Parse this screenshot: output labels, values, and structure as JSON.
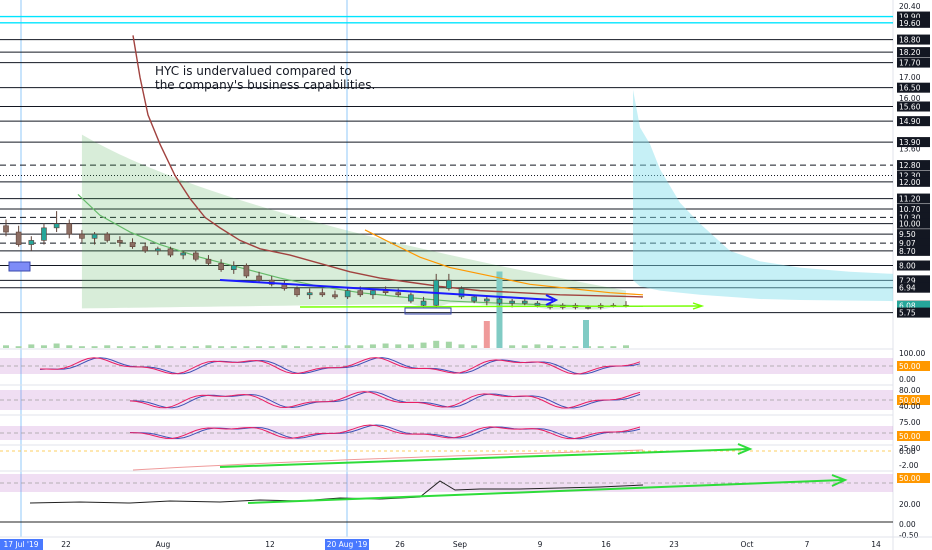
{
  "chart_data": {
    "type": "candlestick",
    "annotation": "HYC is undervalued compared to\nthe company's business capabilities.",
    "price_axis": {
      "labels": [
        "20.40",
        "19.90",
        "19.60",
        "18.80",
        "18.20",
        "17.70",
        "17.00",
        "16.50",
        "16.00",
        "15.60",
        "14.90",
        "13.90",
        "13.60",
        "12.80",
        "12.30",
        "12.00",
        "11.20",
        "10.70",
        "10.30",
        "10.00",
        "9.50",
        "9.07",
        "8.70",
        "8.00",
        "7.29",
        "6.94",
        "6.09",
        "6.08",
        "5.75"
      ],
      "badges": [
        {
          "value": "6.09",
          "color": "#ef5350"
        },
        {
          "value": "6.08",
          "color": "#26a69a"
        },
        {
          "value": "5.75",
          "color": "#131722"
        }
      ],
      "horizontal_levels": [
        {
          "value": "19.90",
          "color": "#00e5ff",
          "style": "solid"
        },
        {
          "value": "19.60",
          "color": "#00e5ff",
          "style": "solid"
        },
        {
          "value": "18.80",
          "color": "#131722",
          "style": "solid"
        },
        {
          "value": "18.20",
          "color": "#131722",
          "style": "solid"
        },
        {
          "value": "17.70",
          "color": "#131722",
          "style": "solid"
        },
        {
          "value": "16.50",
          "color": "#131722",
          "style": "solid"
        },
        {
          "value": "15.60",
          "color": "#131722",
          "style": "solid"
        },
        {
          "value": "14.90",
          "color": "#131722",
          "style": "solid"
        },
        {
          "value": "13.90",
          "color": "#131722",
          "style": "solid"
        },
        {
          "value": "12.80",
          "color": "#131722",
          "style": "dashed"
        },
        {
          "value": "12.30",
          "color": "#131722",
          "style": "dotted"
        },
        {
          "value": "12.00",
          "color": "#131722",
          "style": "solid"
        },
        {
          "value": "11.20",
          "color": "#131722",
          "style": "solid"
        },
        {
          "value": "10.70",
          "color": "#131722",
          "style": "solid"
        },
        {
          "value": "10.30",
          "color": "#131722",
          "style": "dashed"
        },
        {
          "value": "10.00",
          "color": "#131722",
          "style": "solid"
        },
        {
          "value": "9.50",
          "color": "#131722",
          "style": "solid"
        },
        {
          "value": "9.07",
          "color": "#131722",
          "style": "dashed"
        },
        {
          "value": "8.70",
          "color": "#131722",
          "style": "solid"
        },
        {
          "value": "8.00",
          "color": "#131722",
          "style": "solid"
        },
        {
          "value": "7.29",
          "color": "#131722",
          "style": "solid"
        },
        {
          "value": "6.94",
          "color": "#131722",
          "style": "solid"
        },
        {
          "value": "5.75",
          "color": "#131722",
          "style": "solid"
        }
      ]
    },
    "time_axis": {
      "labels": [
        "17 Jul '19",
        "22",
        "Aug",
        "12",
        "20 Aug '19",
        "26",
        "Sep",
        "9",
        "16",
        "23",
        "Oct",
        "7",
        "14"
      ],
      "highlighted": [
        "17 Jul '19",
        "20 Aug '19"
      ]
    },
    "candles": [
      {
        "o": 9.9,
        "h": 10.2,
        "l": 9.4,
        "c": 9.6
      },
      {
        "o": 9.6,
        "h": 9.9,
        "l": 8.9,
        "c": 9.0
      },
      {
        "o": 9.0,
        "h": 9.4,
        "l": 8.7,
        "c": 9.2
      },
      {
        "o": 9.2,
        "h": 10.0,
        "l": 9.0,
        "c": 9.8
      },
      {
        "o": 9.8,
        "h": 10.6,
        "l": 9.6,
        "c": 10.0
      },
      {
        "o": 10.0,
        "h": 10.2,
        "l": 9.3,
        "c": 9.5
      },
      {
        "o": 9.5,
        "h": 9.7,
        "l": 9.1,
        "c": 9.3
      },
      {
        "o": 9.3,
        "h": 9.6,
        "l": 9.0,
        "c": 9.5
      },
      {
        "o": 9.5,
        "h": 9.6,
        "l": 9.1,
        "c": 9.2
      },
      {
        "o": 9.2,
        "h": 9.4,
        "l": 8.9,
        "c": 9.1
      },
      {
        "o": 9.1,
        "h": 9.3,
        "l": 8.8,
        "c": 8.9
      },
      {
        "o": 8.9,
        "h": 9.1,
        "l": 8.6,
        "c": 8.7
      },
      {
        "o": 8.7,
        "h": 8.9,
        "l": 8.5,
        "c": 8.8
      },
      {
        "o": 8.8,
        "h": 8.9,
        "l": 8.4,
        "c": 8.5
      },
      {
        "o": 8.5,
        "h": 8.7,
        "l": 8.3,
        "c": 8.6
      },
      {
        "o": 8.6,
        "h": 8.7,
        "l": 8.2,
        "c": 8.3
      },
      {
        "o": 8.3,
        "h": 8.5,
        "l": 8.0,
        "c": 8.1
      },
      {
        "o": 8.1,
        "h": 8.3,
        "l": 7.7,
        "c": 7.8
      },
      {
        "o": 7.8,
        "h": 8.2,
        "l": 7.6,
        "c": 8.0
      },
      {
        "o": 8.0,
        "h": 8.1,
        "l": 7.4,
        "c": 7.5
      },
      {
        "o": 7.5,
        "h": 7.7,
        "l": 7.2,
        "c": 7.3
      },
      {
        "o": 7.3,
        "h": 7.5,
        "l": 7.0,
        "c": 7.1
      },
      {
        "o": 7.1,
        "h": 7.3,
        "l": 6.8,
        "c": 6.9
      },
      {
        "o": 6.9,
        "h": 7.0,
        "l": 6.5,
        "c": 6.6
      },
      {
        "o": 6.6,
        "h": 6.9,
        "l": 6.4,
        "c": 6.7
      },
      {
        "o": 6.7,
        "h": 6.9,
        "l": 6.5,
        "c": 6.6
      },
      {
        "o": 6.6,
        "h": 6.8,
        "l": 6.4,
        "c": 6.5
      },
      {
        "o": 6.5,
        "h": 6.9,
        "l": 6.4,
        "c": 6.8
      },
      {
        "o": 6.8,
        "h": 7.0,
        "l": 6.5,
        "c": 6.6
      },
      {
        "o": 6.6,
        "h": 6.9,
        "l": 6.4,
        "c": 6.8
      },
      {
        "o": 6.8,
        "h": 7.0,
        "l": 6.6,
        "c": 6.7
      },
      {
        "o": 6.7,
        "h": 6.9,
        "l": 6.5,
        "c": 6.6
      },
      {
        "o": 6.6,
        "h": 6.7,
        "l": 6.2,
        "c": 6.3
      },
      {
        "o": 6.3,
        "h": 6.5,
        "l": 6.0,
        "c": 6.1
      },
      {
        "o": 6.1,
        "h": 7.6,
        "l": 6.0,
        "c": 7.3
      },
      {
        "o": 7.3,
        "h": 7.6,
        "l": 6.8,
        "c": 6.9
      },
      {
        "o": 6.9,
        "h": 7.0,
        "l": 6.4,
        "c": 6.5
      },
      {
        "o": 6.5,
        "h": 6.6,
        "l": 6.2,
        "c": 6.3
      },
      {
        "o": 6.3,
        "h": 6.5,
        "l": 6.1,
        "c": 6.4
      },
      {
        "o": 6.4,
        "h": 6.5,
        "l": 6.1,
        "c": 6.2
      },
      {
        "o": 6.2,
        "h": 6.4,
        "l": 6.0,
        "c": 6.3
      },
      {
        "o": 6.3,
        "h": 6.4,
        "l": 6.1,
        "c": 6.2
      },
      {
        "o": 6.2,
        "h": 6.3,
        "l": 6.0,
        "c": 6.1
      },
      {
        "o": 6.1,
        "h": 6.2,
        "l": 5.9,
        "c": 6.0
      },
      {
        "o": 6.0,
        "h": 6.2,
        "l": 5.9,
        "c": 6.1
      },
      {
        "o": 6.1,
        "h": 6.2,
        "l": 5.9,
        "c": 6.0
      },
      {
        "o": 6.0,
        "h": 6.1,
        "l": 5.9,
        "c": 6.0
      },
      {
        "o": 6.0,
        "h": 6.2,
        "l": 5.9,
        "c": 6.1
      },
      {
        "o": 6.1,
        "h": 6.2,
        "l": 6.0,
        "c": 6.1
      },
      {
        "o": 6.1,
        "h": 6.3,
        "l": 6.0,
        "c": 6.1
      }
    ],
    "oscillators": [
      {
        "name": "osc1",
        "axis_labels": [
          "100.00",
          "50.00",
          "0.00"
        ],
        "band_label": "50.00"
      },
      {
        "name": "osc2",
        "axis_labels": [
          "80.00",
          "50.00",
          "40.00"
        ],
        "band_label": "50.00"
      },
      {
        "name": "osc3",
        "axis_labels": [
          "75.00",
          "50.00",
          "25.00"
        ],
        "band_label": "50.00"
      },
      {
        "name": "osc4",
        "axis_labels": [
          "0.00",
          "-2.00"
        ]
      },
      {
        "name": "osc5",
        "axis_labels": [
          "50.00",
          "20.00",
          "0.00",
          "-0.50"
        ],
        "band_label": "50.00"
      }
    ]
  }
}
